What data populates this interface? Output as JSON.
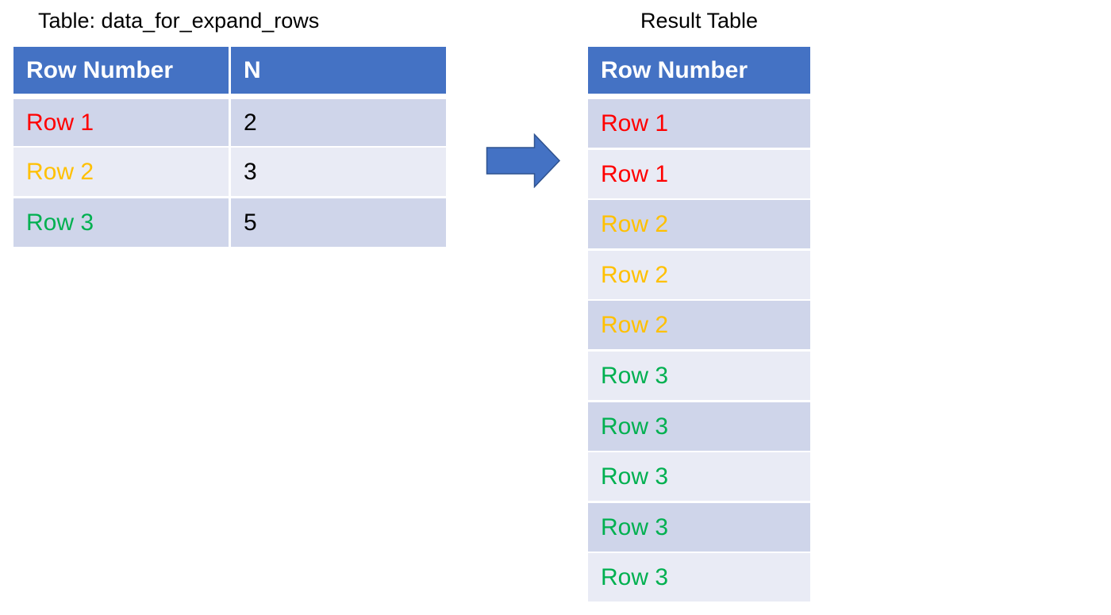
{
  "source_table": {
    "caption": "Table: data_for_expand_rows",
    "columns": [
      "Row Number",
      "N"
    ],
    "rows": [
      {
        "row_number": "Row 1",
        "n": "2",
        "color": "#ff0000"
      },
      {
        "row_number": "Row 2",
        "n": "3",
        "color": "#ffc000"
      },
      {
        "row_number": "Row 3",
        "n": "5",
        "color": "#00b050"
      }
    ]
  },
  "arrow": {
    "icon": "right-arrow-icon",
    "color": "#4472c4",
    "stroke": "#2f528f"
  },
  "result_table": {
    "caption": "Result Table",
    "columns": [
      "Row Number"
    ],
    "rows": [
      {
        "row_number": "Row 1",
        "color": "#ff0000"
      },
      {
        "row_number": "Row 1",
        "color": "#ff0000"
      },
      {
        "row_number": "Row 2",
        "color": "#ffc000"
      },
      {
        "row_number": "Row 2",
        "color": "#ffc000"
      },
      {
        "row_number": "Row 2",
        "color": "#ffc000"
      },
      {
        "row_number": "Row 3",
        "color": "#00b050"
      },
      {
        "row_number": "Row 3",
        "color": "#00b050"
      },
      {
        "row_number": "Row 3",
        "color": "#00b050"
      },
      {
        "row_number": "Row 3",
        "color": "#00b050"
      },
      {
        "row_number": "Row 3",
        "color": "#00b050"
      }
    ]
  },
  "colors": {
    "header_bg": "#4472c4",
    "band_dark": "#cfd5ea",
    "band_light": "#e9ebf5"
  }
}
